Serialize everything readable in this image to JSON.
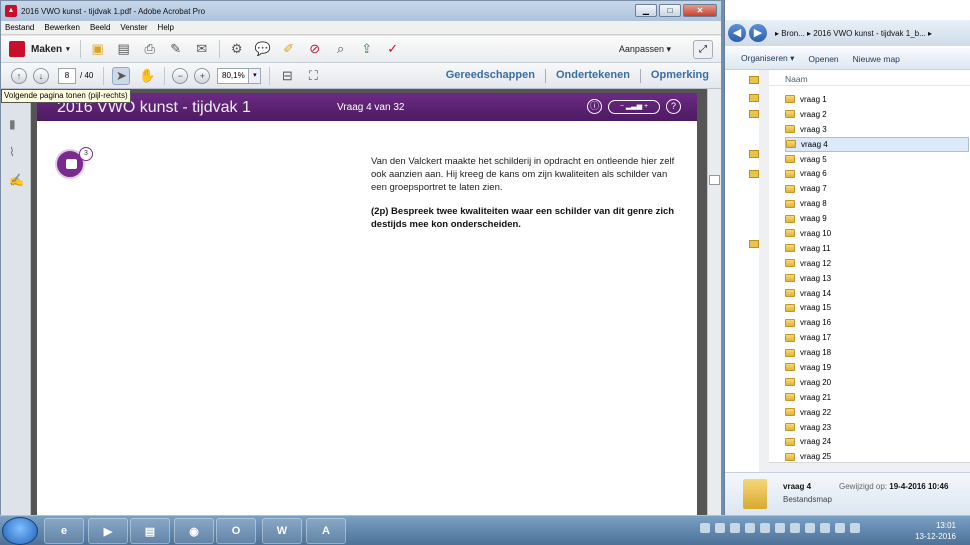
{
  "acrobat": {
    "title": "2016 VWO kunst - tijdvak 1.pdf - Adobe Acrobat Pro",
    "window_buttons": {
      "min": "▁",
      "max": "□",
      "close": "✕"
    },
    "menu": [
      "Bestand",
      "Bewerken",
      "Beeld",
      "Venster",
      "Help"
    ],
    "maken_label": "Maken",
    "aanpassen_label": "Aanpassen",
    "page_current": "8",
    "page_total": "/ 40",
    "zoom": "80,1%",
    "right_tabs": [
      "Gereedschappen",
      "Ondertekenen",
      "Opmerking"
    ],
    "tooltip": "Volgende pagina tonen (pijl-rechts)"
  },
  "document": {
    "header_title": "2016 VWO kunst - tijdvak 1",
    "header_question": "Vraag 4 van 32",
    "bookmark_badge": "3",
    "body_text": "Van den Valckert maakte het schilderij in opdracht en ontleende hier zelf ook aanzien aan. Hij kreeg de kans om zijn kwaliteiten als schilder van een groepsportret te laten zien.",
    "question_text": "(2p) Bespreek twee kwaliteiten waar een schilder van dit genre zich destijds mee kon onderscheiden."
  },
  "explorer": {
    "breadcrumb": "▸ Bron... ▸ 2016 VWO kunst - tijdvak 1_b... ▸",
    "commands": [
      "Organiseren ▾",
      "Openen",
      "Nieuwe map"
    ],
    "column_name": "Naam",
    "folders": [
      "vraag 1",
      "vraag 2",
      "vraag 3",
      "vraag 4",
      "vraag 5",
      "vraag 6",
      "vraag 7",
      "vraag 8",
      "vraag 9",
      "vraag 10",
      "vraag 11",
      "vraag 12",
      "vraag 13",
      "vraag 14",
      "vraag 15",
      "vraag 16",
      "vraag 17",
      "vraag 18",
      "vraag 19",
      "vraag 20",
      "vraag 21",
      "vraag 22",
      "vraag 23",
      "vraag 24",
      "vraag 25"
    ],
    "selected_folder": "vraag 4",
    "details": {
      "name": "vraag 4",
      "type": "Bestandsmap",
      "modified_label": "Gewijzigd op:",
      "modified_value": "19-4-2016 10:46"
    }
  },
  "taskbar": {
    "time": "13:01",
    "date": "13-12-2016",
    "apps": [
      "ie-icon",
      "media-icon",
      "explorer-icon",
      "chrome-icon",
      "outlook-icon",
      "word-icon",
      "acrobat-icon"
    ]
  }
}
